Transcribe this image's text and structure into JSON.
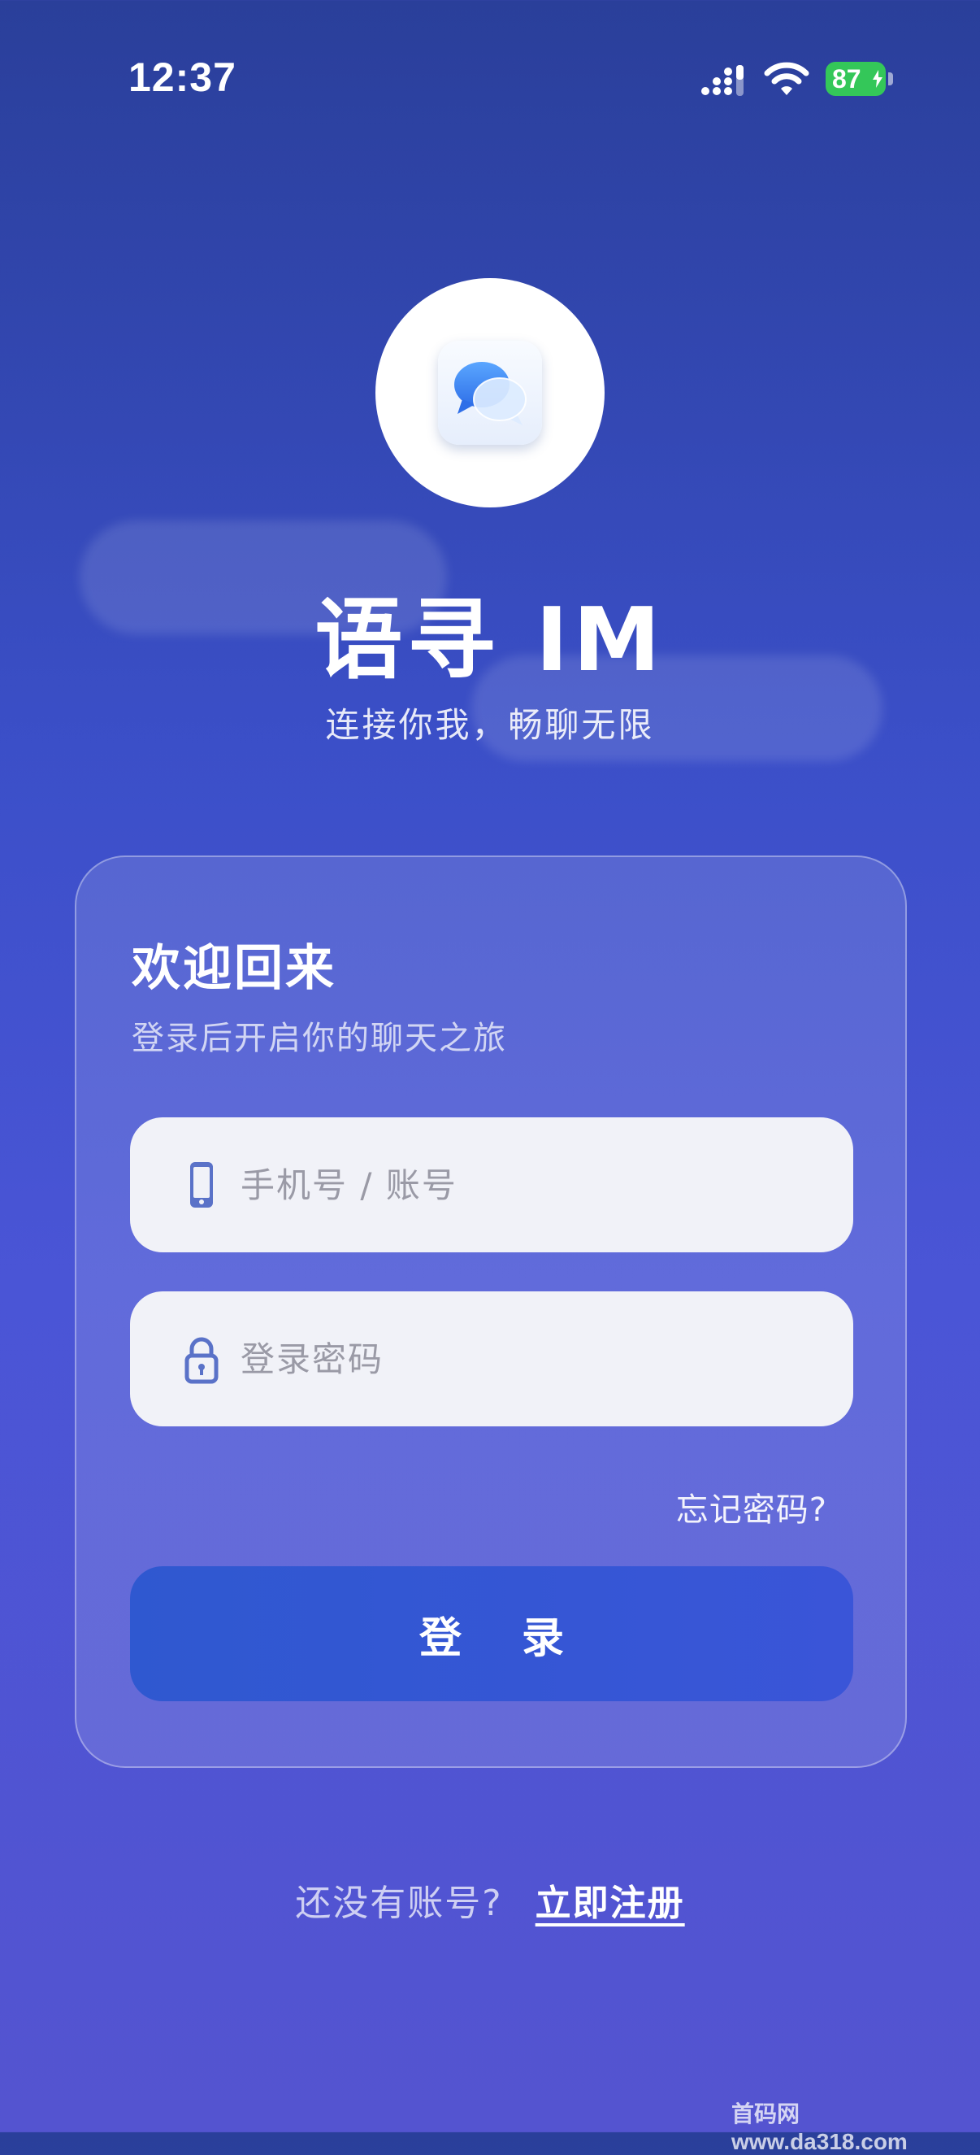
{
  "status_bar": {
    "time": "12:37",
    "battery_level": "87",
    "signal_icon": "cellular-signal-icon",
    "wifi_icon": "wifi-icon",
    "battery_icon": "battery-charging-icon"
  },
  "app": {
    "title": "语寻 IM",
    "subtitle": "连接你我，畅聊无限",
    "logo_icon": "chat-bubbles-icon"
  },
  "login_card": {
    "title": "欢迎回来",
    "subtitle": "登录后开启你的聊天之旅",
    "account_field": {
      "placeholder": "手机号 / 账号",
      "value": "",
      "icon": "phone-icon"
    },
    "password_field": {
      "placeholder": "登录密码",
      "value": "",
      "icon": "lock-icon"
    },
    "forgot_password": "忘记密码?",
    "login_button": "登 录"
  },
  "register": {
    "prompt": "还没有账号?",
    "link": "立即注册"
  },
  "watermark": "首码网 www.da318.com",
  "colors": {
    "background_top": "#2a3f9a",
    "background_bottom": "#5454d0",
    "login_button": "#3a55d8",
    "battery": "#34c759"
  }
}
